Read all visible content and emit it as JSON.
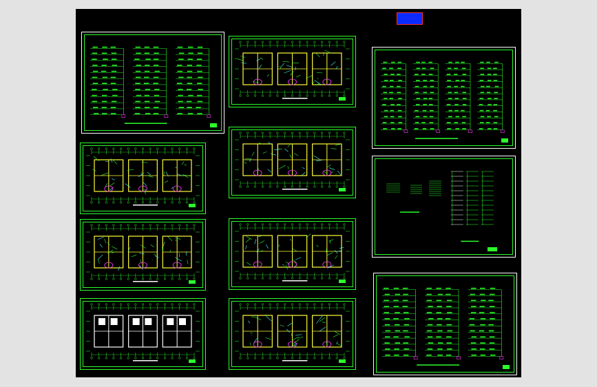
{
  "app": {
    "background": "#000000",
    "frame_color": "#e3e3e3"
  },
  "colors": {
    "border_white": "#ffffff",
    "line_green": "#2cff2c",
    "wall_yellow": "#ffff3a",
    "text_cyan": "#4affff",
    "accent_magenta": "#ff3aff",
    "stamp_blue": "#0a2bff",
    "stamp_red": "#ff2b2b"
  },
  "drawing": {
    "title_stamp": "· · · · · · · ·",
    "sheets": [
      {
        "id": "s1",
        "kind": "riser",
        "icon": "riser-diagram-icon"
      },
      {
        "id": "s2",
        "kind": "plan",
        "icon": "floor-plan-icon"
      },
      {
        "id": "s3",
        "kind": "plan",
        "icon": "floor-plan-icon"
      },
      {
        "id": "s4",
        "kind": "plan",
        "icon": "floor-plan-icon"
      },
      {
        "id": "s5",
        "kind": "plan",
        "icon": "floor-plan-icon"
      },
      {
        "id": "s6",
        "kind": "plan",
        "icon": "floor-plan-icon"
      },
      {
        "id": "s7",
        "kind": "plan",
        "icon": "floor-plan-icon"
      },
      {
        "id": "s8",
        "kind": "plan",
        "icon": "floor-plan-icon"
      },
      {
        "id": "s9",
        "kind": "riser",
        "icon": "riser-diagram-icon"
      },
      {
        "id": "s10",
        "kind": "system",
        "icon": "system-diagram-icon"
      },
      {
        "id": "s11",
        "kind": "riser",
        "icon": "riser-diagram-icon"
      }
    ]
  }
}
